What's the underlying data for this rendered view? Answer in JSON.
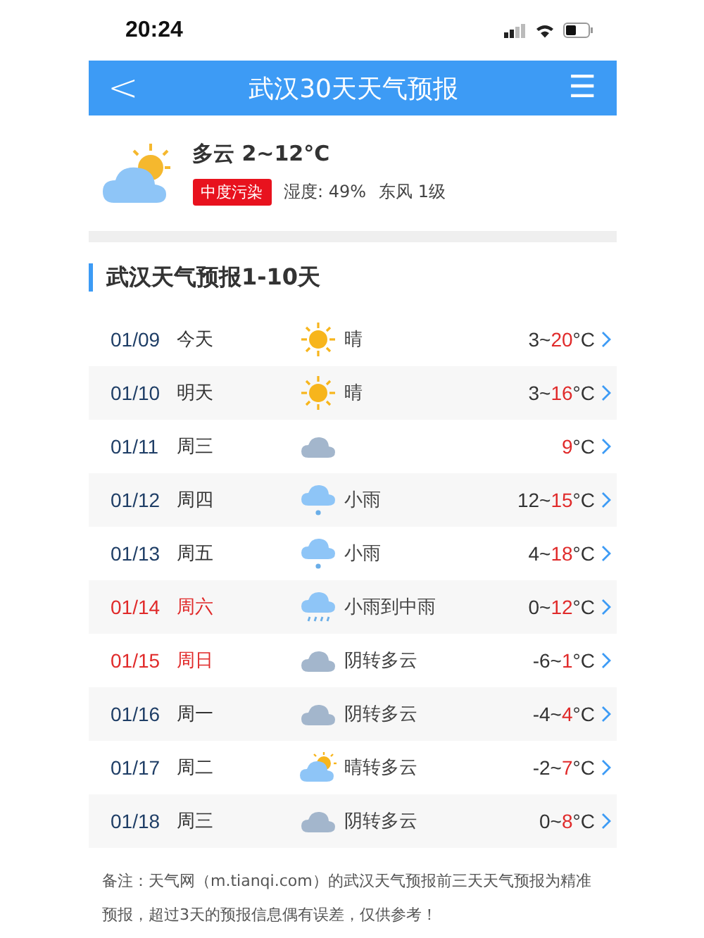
{
  "status_bar": {
    "time": "20:24"
  },
  "header": {
    "back": "<",
    "title": "武汉30天天气预报",
    "menu": "☰"
  },
  "current": {
    "weather": "多云 2~12°C",
    "air_quality": "中度污染",
    "humidity": "湿度: 49%",
    "wind": "东风 1级"
  },
  "section_title": "武汉天气预报1-10天",
  "days": [
    {
      "date": "01/09",
      "day": "今天",
      "weekend": false,
      "kind": "sun",
      "weather": "晴",
      "low": "3~",
      "high": "20",
      "unit": "°C"
    },
    {
      "date": "01/10",
      "day": "明天",
      "weekend": false,
      "kind": "sun",
      "weather": "晴",
      "low": "3~",
      "high": "16",
      "unit": "°C"
    },
    {
      "date": "01/11",
      "day": "周三",
      "weekend": false,
      "kind": "cloud",
      "high": "9",
      "unit": "°C"
    },
    {
      "date": "01/12",
      "day": "周四",
      "weekend": false,
      "kind": "rain",
      "weather": "小雨",
      "low": "12~",
      "high": "15",
      "unit": "°C"
    },
    {
      "date": "01/13",
      "day": "周五",
      "weekend": false,
      "kind": "rain",
      "weather": "小雨",
      "low": "4~",
      "high": "18",
      "unit": "°C"
    },
    {
      "date": "01/14",
      "day": "周六",
      "weekend": true,
      "kind": "heavyrain",
      "weather": "小雨到中雨",
      "low": "0~",
      "high": "12",
      "unit": "°C"
    },
    {
      "date": "01/15",
      "day": "周日",
      "weekend": true,
      "kind": "cloud",
      "weather": "阴转多云",
      "low": "-6~",
      "high": "1",
      "unit": "°C"
    },
    {
      "date": "01/16",
      "day": "周一",
      "weekend": false,
      "kind": "cloud",
      "weather": "阴转多云",
      "low": "-4~",
      "high": "4",
      "unit": "°C"
    },
    {
      "date": "01/17",
      "day": "周二",
      "weekend": false,
      "kind": "suncloud",
      "weather": "晴转多云",
      "low": "-2~",
      "high": "7",
      "unit": "°C"
    },
    {
      "date": "01/18",
      "day": "周三",
      "weekend": false,
      "kind": "cloud",
      "weather": "阴转多云",
      "low": "0~",
      "high": "8",
      "unit": "°C"
    }
  ],
  "note": "备注：天气网（m.tianqi.com）的武汉天气预报前三天天气预报为精准预报，超过3天的预报信息偶有误差，仅供参考！"
}
